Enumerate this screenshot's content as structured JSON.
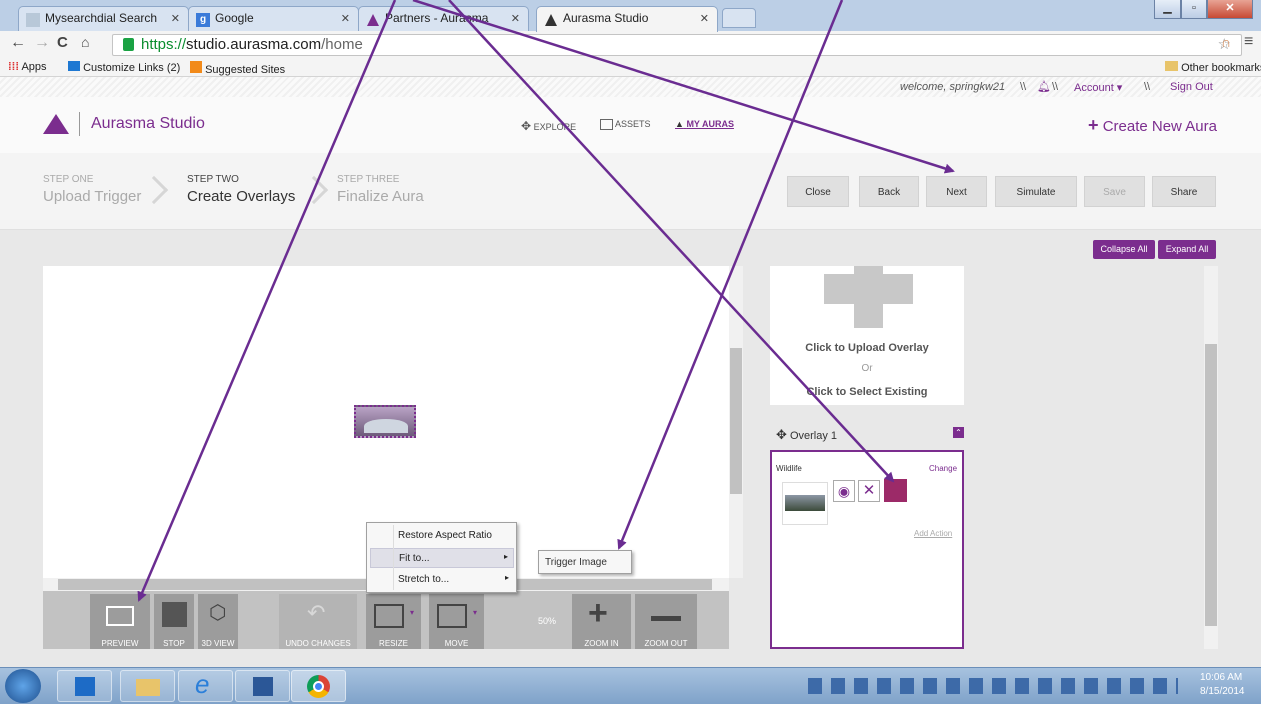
{
  "browser": {
    "tabs": [
      {
        "title": "Mysearchdial Search"
      },
      {
        "title": "Google"
      },
      {
        "title": "Partners - Aurasma"
      },
      {
        "title": "Aurasma Studio"
      }
    ],
    "url_scheme": "https://",
    "url_host": "studio.aurasma.com",
    "url_path": "/home",
    "bookmarks": [
      {
        "label": "Apps"
      },
      {
        "label": "Customize Links (2)"
      },
      {
        "label": "Suggested Sites"
      }
    ],
    "other_bookmarks": "Other bookmarks"
  },
  "account": {
    "welcome": "welcome, springkw21",
    "sep1": "\\\\",
    "sep2": "\\\\",
    "sep3": "\\\\",
    "account_label": "Account",
    "sign_out": "Sign Out"
  },
  "app": {
    "brand": "Aurasma Studio",
    "nav": [
      {
        "label": "EXPLORE"
      },
      {
        "label": "ASSETS"
      },
      {
        "label": "MY AURAS"
      }
    ],
    "create_new": "Create New Aura"
  },
  "steps": [
    {
      "key": "STEP ONE",
      "label": "Upload Trigger"
    },
    {
      "key": "STEP TWO",
      "label": "Create Overlays"
    },
    {
      "key": "STEP THREE",
      "label": "Finalize Aura"
    }
  ],
  "actions": {
    "close": "Close",
    "back": "Back",
    "next": "Next",
    "simulate": "Simulate",
    "save": "Save",
    "share": "Share"
  },
  "panel": {
    "collapse_all": "Collapse All",
    "expand_all": "Expand All",
    "upload_overlay": "Click to Upload Overlay",
    "or": "Or",
    "select_existing": "Click to Select Existing",
    "overlay_title": "Overlay 1",
    "overlay_name": "Wildlife",
    "change": "Change",
    "add_action": "Add Action"
  },
  "toolbar": {
    "preview": "PREVIEW",
    "stop": "STOP",
    "view3d": "3D VIEW",
    "undo": "UNDO CHANGES",
    "resize": "RESIZE",
    "move": "MOVE",
    "zoom_level": "50%",
    "zoom_in": "ZOOM IN",
    "zoom_out": "ZOOM OUT"
  },
  "context_menu": {
    "restore": "Restore Aspect Ratio",
    "fit": "Fit to...",
    "stretch": "Stretch to...",
    "trigger_image": "Trigger Image"
  },
  "taskbar": {
    "time": "10:06 AM",
    "date": "8/15/2014"
  },
  "colors": {
    "brand_purple": "#7b2d8e",
    "annotation_arrow": "#6a2c91"
  }
}
